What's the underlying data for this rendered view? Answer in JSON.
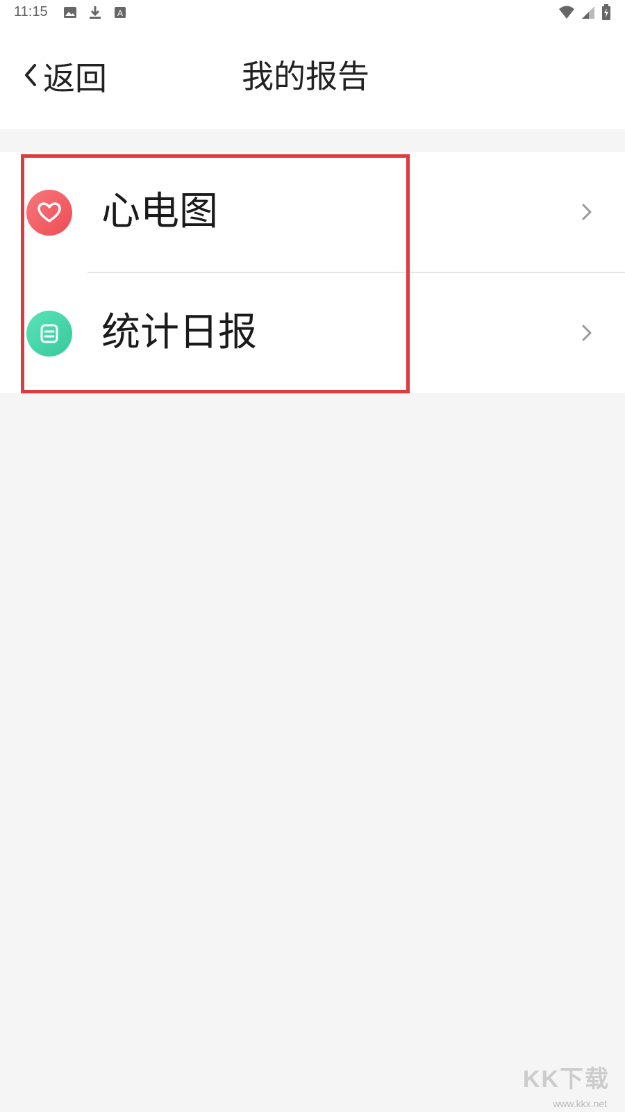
{
  "status_bar": {
    "time": "11:15",
    "left_icons": [
      "image-icon",
      "download-icon",
      "font-a-icon"
    ],
    "right_icons": [
      "wifi-icon",
      "signal-icon",
      "battery-charging-icon"
    ]
  },
  "nav": {
    "back_label": "返回",
    "title": "我的报告"
  },
  "list": {
    "items": [
      {
        "label": "心电图",
        "icon": "heart-icon",
        "icon_color": "#f25a5f"
      },
      {
        "label": "统计日报",
        "icon": "document-icon",
        "icon_color": "#3fd6a8"
      }
    ]
  },
  "highlight_color": "#e0393e",
  "watermark": {
    "text": "KK下载",
    "url": "www.kkx.net"
  }
}
